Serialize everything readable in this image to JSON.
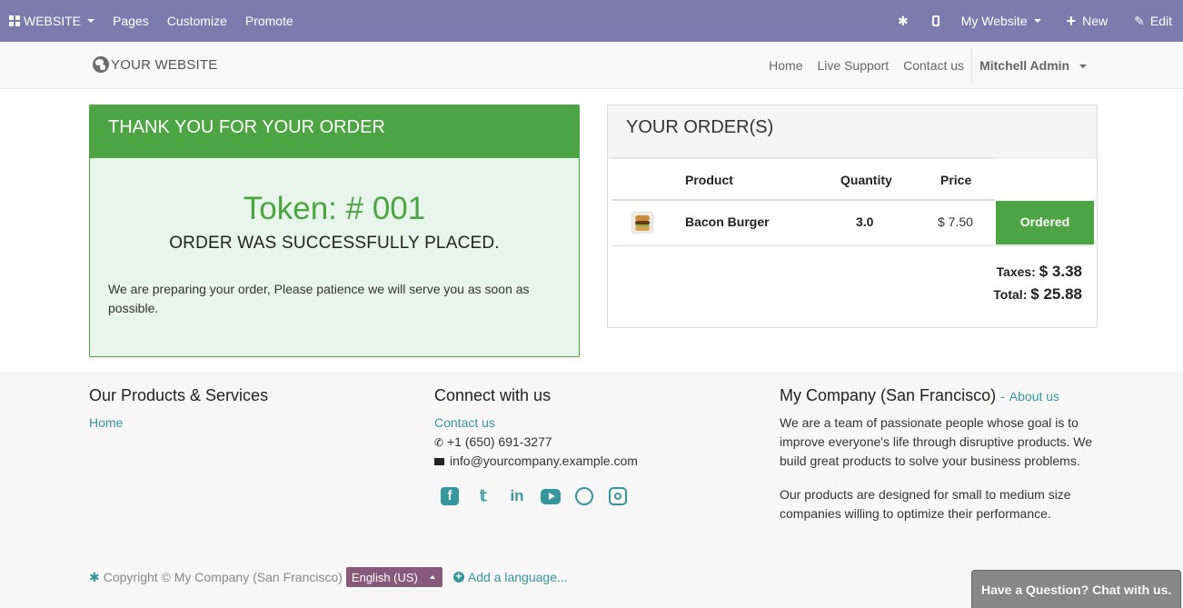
{
  "adminbar": {
    "website_label": "WEBSITE",
    "menu": [
      "Pages",
      "Customize",
      "Promote"
    ],
    "my_website_label": "My Website",
    "new_label": "New",
    "edit_label": "Edit",
    "bg_color": "#7c7bad"
  },
  "header": {
    "logo_text": "YOUR WEBSITE",
    "nav": [
      "Home",
      "Live Support",
      "Contact us"
    ],
    "user": "Mitchell Admin"
  },
  "thankyou": {
    "title": "THANK YOU FOR YOUR ORDER",
    "token": "Token: # 001",
    "status": "ORDER WAS SUCCESSFULLY PLACED.",
    "message": "We are preparing your order, Please patience we will serve you as soon as possible.",
    "accent_color": "#4ca443"
  },
  "orders": {
    "title": "YOUR ORDER(S)",
    "columns": {
      "product": "Product",
      "quantity": "Quantity",
      "price": "Price"
    },
    "items": [
      {
        "image": "burger-thumbnail",
        "product": "Bacon Burger",
        "quantity": "3.0",
        "price": "$ 7.50",
        "status": "Ordered"
      }
    ],
    "taxes_label": "Taxes:",
    "taxes_value": "$ 3.38",
    "total_label": "Total:",
    "total_value": "$ 25.88"
  },
  "footer": {
    "products_title": "Our Products & Services",
    "products_links": [
      "Home"
    ],
    "connect_title": "Connect with us",
    "contact_link": "Contact us",
    "phone": "+1 (650) 691-3277",
    "email": "info@yourcompany.example.com",
    "social_icons": [
      "facebook-icon",
      "twitter-icon",
      "linkedin-icon",
      "youtube-icon",
      "github-icon",
      "instagram-icon"
    ],
    "company_title": "My Company (San Francisco)",
    "company_sep": "-",
    "about_link": "About us",
    "about_p1": "We are a team of passionate people whose goal is to improve everyone's life through disruptive products. We build great products to solve your business problems.",
    "about_p2": "Our products are designed for small to medium size companies willing to optimize their performance.",
    "copyright": "Copyright © My Company (San Francisco)",
    "language": "English (US)",
    "add_language": "Add a language...",
    "link_color": "#35979c"
  },
  "chat": {
    "label": "Have a Question? Chat with us."
  }
}
